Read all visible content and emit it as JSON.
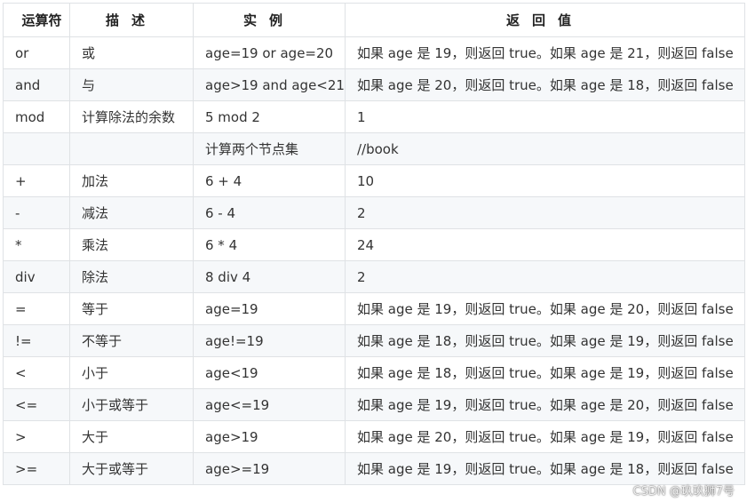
{
  "header": {
    "operator": "运算符",
    "description": "描述",
    "example": "实例",
    "return_value": "返回值"
  },
  "rows": [
    {
      "op": "or",
      "desc": "或",
      "example": "age=19 or age=20",
      "ret": "如果 age 是 19，则返回 true。如果 age 是 21，则返回 false"
    },
    {
      "op": "and",
      "desc": "与",
      "example": "age>19 and age<21",
      "ret": "如果 age 是 20，则返回 true。如果 age 是 18，则返回 false"
    },
    {
      "op": "mod",
      "desc": "计算除法的余数",
      "example": "5 mod 2",
      "ret": "1"
    },
    {
      "op": "",
      "desc": "",
      "example": "计算两个节点集",
      "ret": "//book"
    },
    {
      "op": "+",
      "desc": "加法",
      "example": "6 + 4",
      "ret": "10"
    },
    {
      "op": "-",
      "desc": "减法",
      "example": "6 - 4",
      "ret": "2"
    },
    {
      "op": "*",
      "desc": "乘法",
      "example": "6 * 4",
      "ret": "24"
    },
    {
      "op": "div",
      "desc": "除法",
      "example": "8 div 4",
      "ret": "2"
    },
    {
      "op": "=",
      "desc": "等于",
      "example": "age=19",
      "ret": "如果 age 是 19，则返回 true。如果 age 是 20，则返回 false"
    },
    {
      "op": "!=",
      "desc": "不等于",
      "example": "age!=19",
      "ret": "如果 age 是 18，则返回 true。如果 age 是 19，则返回 false"
    },
    {
      "op": "<",
      "desc": "小于",
      "example": "age<19",
      "ret": "如果 age 是 18，则返回 true。如果 age 是 19，则返回 false"
    },
    {
      "op": "<=",
      "desc": "小于或等于",
      "example": "age<=19",
      "ret": "如果 age 是 19，则返回 true。如果 age 是 20，则返回 false"
    },
    {
      "op": ">",
      "desc": "大于",
      "example": "age>19",
      "ret": "如果 age 是 20，则返回 true。如果 age 是 19，则返回 false"
    },
    {
      "op": ">=",
      "desc": "大于或等于",
      "example": "age>=19",
      "ret": "如果 age 是 19，则返回 true。如果 age 是 18，则返回 false"
    }
  ],
  "watermark": "CSDN @玖玖狮7号"
}
